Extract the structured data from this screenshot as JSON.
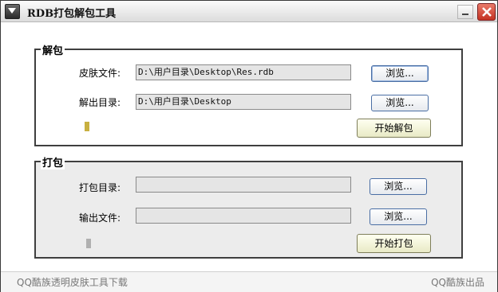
{
  "window": {
    "title": "RDB打包解包工具"
  },
  "unpack": {
    "legend": "解包",
    "skin_file_label": "皮肤文件:",
    "skin_file_value": "D:\\用户目录\\Desktop\\Res.rdb",
    "output_dir_label": "解出目录:",
    "output_dir_value": "D:\\用户目录\\Desktop",
    "browse_label": "浏览...",
    "start_label": "开始解包",
    "progress_color": "#c8b040"
  },
  "pack": {
    "legend": "打包",
    "pack_dir_label": "打包目录:",
    "pack_dir_value": "",
    "output_file_label": "输出文件:",
    "output_file_value": "",
    "browse_label": "浏览...",
    "start_label": "开始打包",
    "progress_color": "#b0b0b0"
  },
  "status": {
    "left": "QQ酷族透明皮肤工具下载",
    "right": "QQ酷族出品"
  }
}
